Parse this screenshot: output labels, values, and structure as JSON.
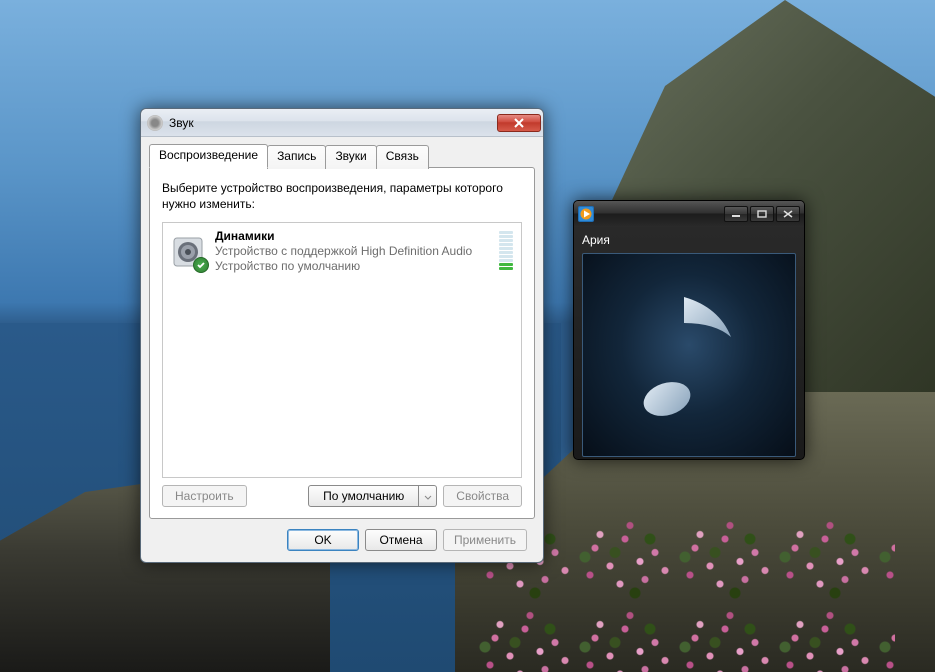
{
  "sound_dialog": {
    "title": "Звук",
    "tabs": {
      "playback": "Воспроизведение",
      "recording": "Запись",
      "sounds": "Звуки",
      "communications": "Связь"
    },
    "instruction": "Выберите устройство воспроизведения, параметры которого нужно изменить:",
    "device": {
      "name": "Динамики",
      "description": "Устройство с поддержкой High Definition Audio",
      "status": "Устройство по умолчанию",
      "level_segments_total": 10,
      "level_segments_on": 2
    },
    "buttons": {
      "configure": "Настроить",
      "set_default": "По умолчанию",
      "properties": "Свойства",
      "ok": "OK",
      "cancel": "Отмена",
      "apply": "Применить"
    }
  },
  "player": {
    "track_title": "Ария"
  }
}
